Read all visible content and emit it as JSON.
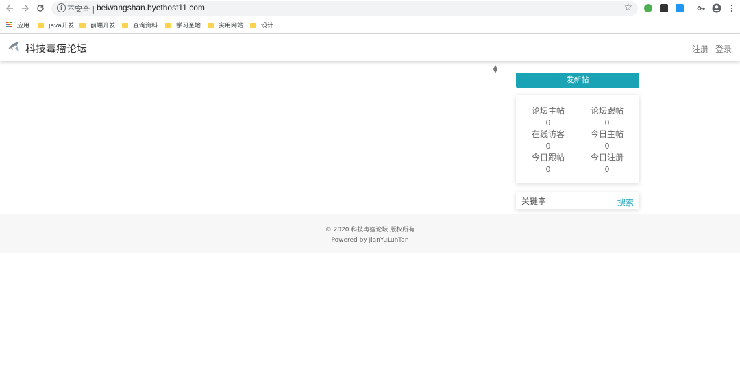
{
  "browser": {
    "security_label": "不安全",
    "separator": "|",
    "url": "beiwangshan.byethost11.com",
    "bookmarks": [
      {
        "label": "应用",
        "icon": "apps-grid-icon"
      },
      {
        "label": "java开发",
        "icon": "folder-icon"
      },
      {
        "label": "前端开发",
        "icon": "folder-icon"
      },
      {
        "label": "查询资料",
        "icon": "folder-icon"
      },
      {
        "label": "学习圣地",
        "icon": "folder-icon"
      },
      {
        "label": "实用网站",
        "icon": "folder-icon"
      },
      {
        "label": "设计",
        "icon": "folder-icon"
      }
    ]
  },
  "site": {
    "brand": "科技毒瘤论坛",
    "nav": {
      "register": "注册",
      "login": "登录"
    }
  },
  "sidebar": {
    "new_post": "发新帖",
    "stats": [
      {
        "label": "论坛主帖",
        "value": "0"
      },
      {
        "label": "论坛跟帖",
        "value": "0"
      },
      {
        "label": "在线访客",
        "value": "0"
      },
      {
        "label": "今日主帖",
        "value": "0"
      },
      {
        "label": "今日跟帖",
        "value": "0"
      },
      {
        "label": "今日注册",
        "value": "0"
      }
    ],
    "search": {
      "placeholder": "关键字",
      "button": "搜索"
    }
  },
  "footer": {
    "copyright": "© 2020 科技毒瘤论坛 版权所有",
    "powered": "Powered by JianYuLunTan"
  },
  "colors": {
    "accent": "#1aa3b5",
    "footer_bg": "#f7f7f7"
  }
}
